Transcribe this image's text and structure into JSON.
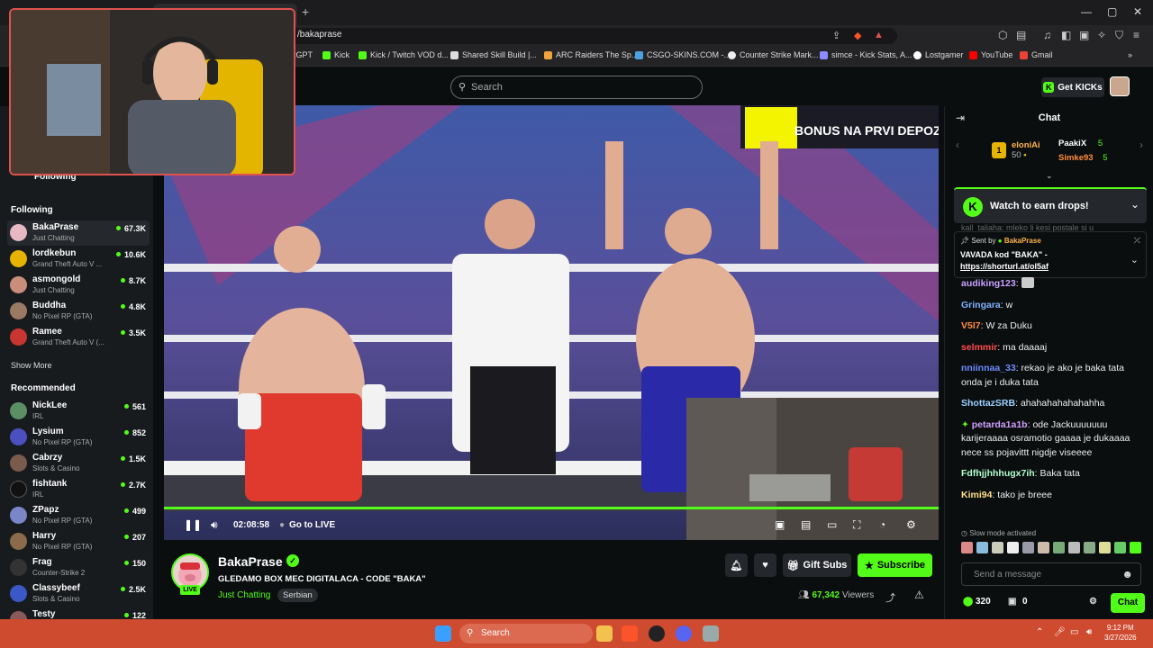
{
  "browser": {
    "url": "/bakaprase",
    "bookmarks": [
      "tGPT",
      "Kick",
      "Kick / Twitch VOD d...",
      "Shared Skill Build |...",
      "ARC Raiders The Sp...",
      "CSGO-SKINS.COM -...",
      "Counter Strike Mark...",
      "simce - Kick Stats, A...",
      "Lostgamer",
      "YouTube",
      "Gmail"
    ]
  },
  "header": {
    "search_placeholder": "Search",
    "get_kicks": "Get KICKs"
  },
  "sidebar": {
    "following_header_partial": "Following",
    "following_label": "Following",
    "following": [
      {
        "name": "BakaPrase",
        "category": "Just Chatting",
        "viewers": "67.3K",
        "color": "#e7b9c2"
      },
      {
        "name": "lordkebun",
        "category": "Grand Theft Auto V ...",
        "viewers": "10.6K",
        "color": "#e6b400"
      },
      {
        "name": "asmongold",
        "category": "Just Chatting",
        "viewers": "8.7K",
        "color": "#c98e7b"
      },
      {
        "name": "Buddha",
        "category": "No Pixel RP (GTA)",
        "viewers": "4.8K",
        "color": "#9a7a63"
      },
      {
        "name": "Ramee",
        "category": "Grand Theft Auto V (...",
        "viewers": "3.5K",
        "color": "#c9362f"
      }
    ],
    "show_more": "Show More",
    "recommended_label": "Recommended",
    "recommended": [
      {
        "name": "NickLee",
        "category": "IRL",
        "viewers": "561",
        "color": "#5c8f63"
      },
      {
        "name": "Lysium",
        "category": "No Pixel RP (GTA)",
        "viewers": "852",
        "color": "#4b4fbf"
      },
      {
        "name": "Cabrzy",
        "category": "Slots & Casino",
        "viewers": "1.5K",
        "color": "#7a5b4d"
      },
      {
        "name": "fishtank",
        "category": "IRL",
        "viewers": "2.7K",
        "color": "#111"
      },
      {
        "name": "ZPapz",
        "category": "No Pixel RP (GTA)",
        "viewers": "499",
        "color": "#7b86c9"
      },
      {
        "name": "Harry",
        "category": "No Pixel RP (GTA)",
        "viewers": "207",
        "color": "#8a6b4b"
      },
      {
        "name": "Frag",
        "category": "Counter-Strike 2",
        "viewers": "150",
        "color": "#333"
      },
      {
        "name": "Classybeef",
        "category": "Slots & Casino",
        "viewers": "2.5K",
        "color": "#3a58c7"
      },
      {
        "name": "Testy",
        "category": "",
        "viewers": "122",
        "color": "#8a5a5a"
      }
    ]
  },
  "video": {
    "overlay_text": "BONUS NA PRVI DEPOZIT",
    "time": "02:08:58",
    "go_live": "Go to LIVE",
    "progress": 1.0
  },
  "stream": {
    "name": "BakaPrase",
    "title": "GLEDAMO BOX MEC DIGITALACA - CODE \"BAKA\"",
    "category": "Just Chatting",
    "tag": "Serbian",
    "live": "LIVE",
    "viewers": "67,342",
    "viewers_label": "Viewers",
    "gift_subs": "Gift Subs",
    "subscribe": "Subscribe"
  },
  "chat": {
    "title": "Chat",
    "leaders": [
      {
        "name": "eloniAi",
        "value": "50"
      },
      {
        "name": "PaakiX",
        "value": "5"
      },
      {
        "name": "Simke93",
        "value": "5"
      }
    ],
    "rank": "1",
    "earn": "Watch to earn drops!",
    "behind_text": "kall_taliaha: mleko li kesi postale si u",
    "pinned_sent_by": "Sent by",
    "pinned_user": "BakaPrase",
    "pinned_text": "VAVADA kod \"BAKA\" -",
    "pinned_link": "https://shorturl.at/ol5af",
    "messages": [
      {
        "user": "audiking123",
        "color": "#c9a0ff",
        "text": ""
      },
      {
        "user": "Gringara",
        "color": "#7fb2ff",
        "text": "w"
      },
      {
        "user": "V5I7",
        "color": "#ff8c3b",
        "text": "W za Duku"
      },
      {
        "user": "selmmir",
        "color": "#ff4d4d",
        "text": "ma daaaaj"
      },
      {
        "user": "nniinnaa_33",
        "color": "#6b8cff",
        "text": "rekao je ako je baka tata onda je i duka tata"
      },
      {
        "user": "ShottazSRB",
        "color": "#9ad0ff",
        "text": "ahahahahahahahha"
      },
      {
        "user": "petarda1a1b",
        "color": "#d0a0ff",
        "text": "ode Jackuuuuuuu karijeraaaa osramotio gaaaa je dukaaaa nece ss pojavittt nigdje viseeee"
      },
      {
        "user": "Fdfhjjhhhugx7ih",
        "color": "#b0ffd0",
        "text": "Baka tata"
      },
      {
        "user": "Kimi94",
        "color": "#ffe08a",
        "text": "tako je breee"
      }
    ],
    "slow_mode": "Slow mode activated",
    "input_placeholder": "Send a message",
    "points": "320",
    "zero": "0",
    "send": "Chat"
  },
  "taskbar": {
    "search": "Search",
    "time": "9:12 PM",
    "date": "3/27/2026"
  }
}
